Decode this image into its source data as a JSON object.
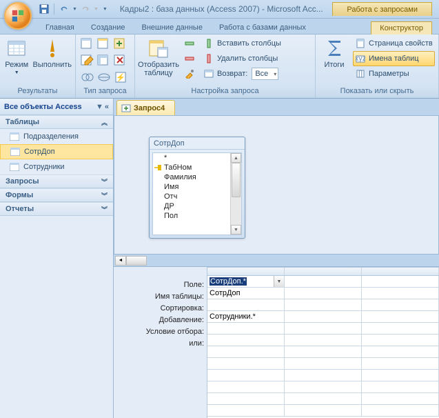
{
  "titlebar": {
    "title": "Кадры2 : база данных (Access 2007) - Microsoft Acc...",
    "context_label": "Работа с запросами"
  },
  "tabs": {
    "home": "Главная",
    "create": "Создание",
    "external": "Внешние данные",
    "dbtools": "Работа с базами данных",
    "design": "Конструктор"
  },
  "ribbon": {
    "results": {
      "mode": "Режим",
      "run": "Выполнить",
      "label": "Результаты"
    },
    "qtype_label": "Тип запроса",
    "setup": {
      "show_table": "Отобразить таблицу",
      "insert_cols": "Вставить столбцы",
      "delete_cols": "Удалить столбцы",
      "return": "Возврат:",
      "return_val": "Все",
      "label": "Настройка запроса"
    },
    "showhide": {
      "totals": "Итоги",
      "prop": "Страница свойств",
      "tnames": "Имена таблиц",
      "params": "Параметры",
      "label": "Показать или скрыть"
    }
  },
  "nav": {
    "header": "Все объекты Access",
    "cat_tables": "Таблицы",
    "items": [
      {
        "label": "Подразделения"
      },
      {
        "label": "СотрДоп"
      },
      {
        "label": "Сотрудники"
      }
    ],
    "cat_queries": "Запросы",
    "cat_forms": "Формы",
    "cat_reports": "Отчеты"
  },
  "doc": {
    "tab": "Запрос4"
  },
  "tablebox": {
    "title": "СотрДоп",
    "fields": [
      "*",
      "ТабНом",
      "Фамилия",
      "Имя",
      "Отч",
      "ДР",
      "Пол"
    ]
  },
  "grid": {
    "labels": {
      "field": "Поле:",
      "table": "Имя таблицы:",
      "sort": "Сортировка:",
      "append": "Добавление:",
      "crit": "Условие отбора:",
      "or": "или:"
    },
    "col1": {
      "field": "СотрДоп.*",
      "table": "СотрДоп",
      "append": "Сотрудники.*"
    }
  }
}
